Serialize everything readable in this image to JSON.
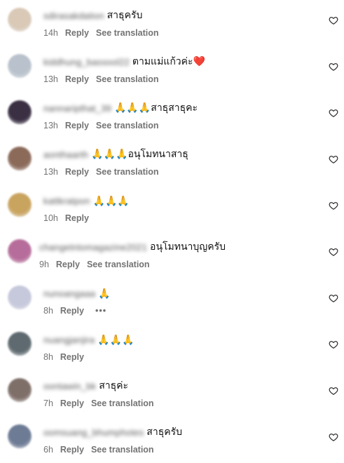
{
  "comments": [
    {
      "username": "sdirasakdation",
      "text": "สาธุครับ",
      "time": "14h",
      "reply": "Reply",
      "translate": "See translation",
      "avatar_color": "#d9c9b6"
    },
    {
      "username": "kiddhung_bassool22",
      "text": "ตามแม่แก้วค่ะ❤️",
      "time": "13h",
      "reply": "Reply",
      "translate": "See translation",
      "avatar_color": "#b9c2cc"
    },
    {
      "username": "nannaripthat_39",
      "text": "🙏🙏🙏สาธุสาธุคะ",
      "time": "13h",
      "reply": "Reply",
      "translate": "See translation",
      "avatar_color": "#3a2f43"
    },
    {
      "username": "aonthaarth",
      "text": "🙏🙏🙏อนุโมทนาสาธุ",
      "time": "13h",
      "reply": "Reply",
      "translate": "See translation",
      "avatar_color": "#8c6a5a"
    },
    {
      "username": "kattkratpon",
      "text": "🙏🙏🙏",
      "time": "10h",
      "reply": "Reply",
      "translate": "",
      "avatar_color": "#c9a45f"
    },
    {
      "username": "changetntomagazine2021",
      "text": "อนุโมทนาบุญครับ",
      "time": "9h",
      "reply": "Reply",
      "translate": "See translation",
      "avatar_color": "#b76d9b"
    },
    {
      "username": "nunoangaaa",
      "text": "🙏",
      "time": "8h",
      "reply": "Reply",
      "translate": "",
      "more": "•••",
      "avatar_color": "#c6c8dc"
    },
    {
      "username": "nuangjanjira",
      "text": "🙏🙏🙏",
      "time": "8h",
      "reply": "Reply",
      "translate": "",
      "avatar_color": "#5e6a70"
    },
    {
      "username": "oontawin_bk",
      "text": "สาธุค่ะ",
      "time": "7h",
      "reply": "Reply",
      "translate": "See translation",
      "avatar_color": "#7f6f69"
    },
    {
      "username": "oomsuang_bhumphotes",
      "text": "สาธุครับ",
      "time": "6h",
      "reply": "Reply",
      "translate": "See translation",
      "avatar_color": "#6d7b95"
    }
  ],
  "icons": {
    "like": "heart-outline-icon",
    "more": "more-dots-icon"
  }
}
